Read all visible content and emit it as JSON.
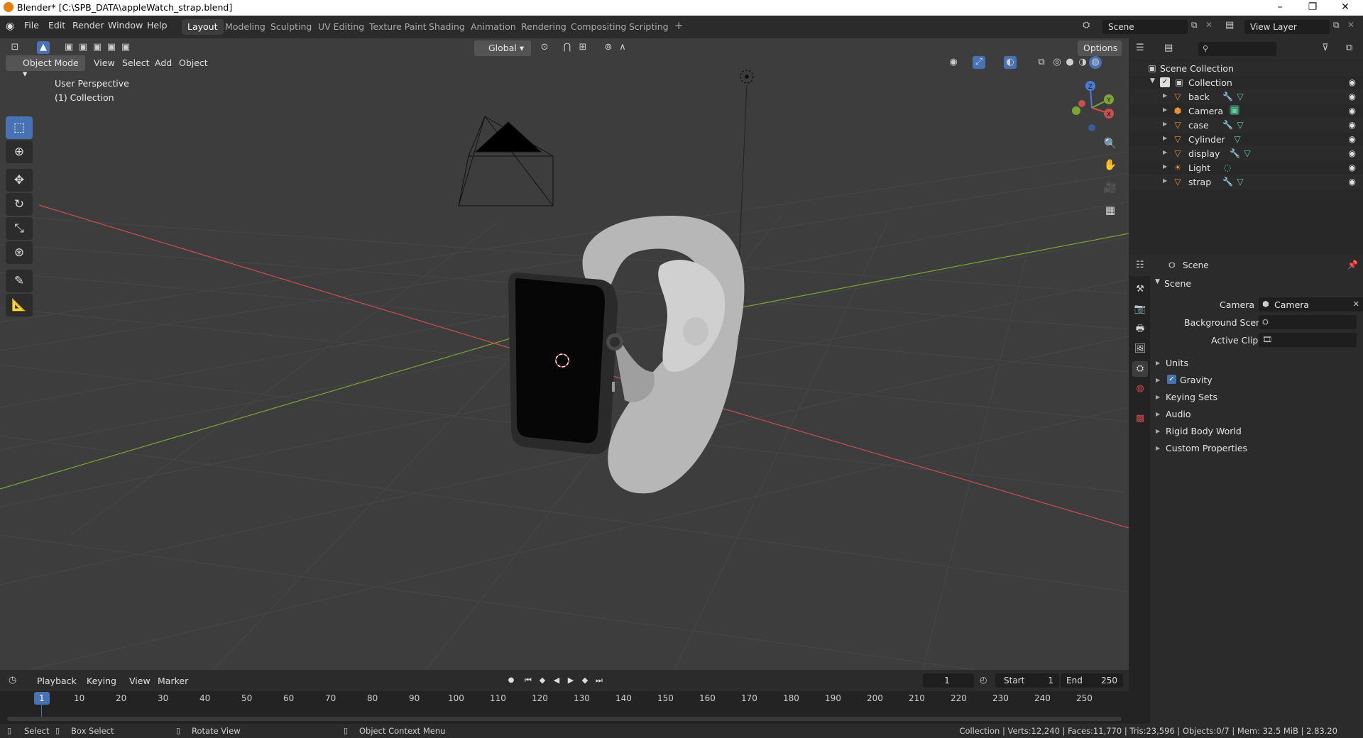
{
  "window": {
    "title": "Blender* [C:\\SPB_DATA\\appleWatch_strap.blend]",
    "minimize": "–",
    "maximize": "❐",
    "close": "✕"
  },
  "menubar": {
    "items": [
      "File",
      "Edit",
      "Render",
      "Window",
      "Help"
    ]
  },
  "workspaces": {
    "tabs": [
      "Layout",
      "Modeling",
      "Sculpting",
      "UV Editing",
      "Texture Paint",
      "Shading",
      "Animation",
      "Rendering",
      "Compositing",
      "Scripting"
    ],
    "add": "+",
    "active": "Layout"
  },
  "scene_selector": {
    "value": "Scene"
  },
  "view_layer_selector": {
    "value": "View Layer"
  },
  "viewport": {
    "orientation": "Global",
    "options": "Options",
    "mode": "Object Mode",
    "menus": [
      "View",
      "Select",
      "Add",
      "Object"
    ],
    "overlay_title": "User Perspective",
    "overlay_collection": "(1) Collection",
    "gizmo": {
      "x": "X",
      "y": "Y",
      "z": "Z"
    }
  },
  "outliner": {
    "search_placeholder": "",
    "root": "Scene Collection",
    "collection": "Collection",
    "objects": [
      {
        "name": "back",
        "icon": "mesh-icon",
        "extras": [
          "wrench-icon",
          "mesh-data-icon"
        ]
      },
      {
        "name": "Camera",
        "icon": "camera-icon",
        "extras": [
          "camera-data-icon"
        ]
      },
      {
        "name": "case",
        "icon": "mesh-icon",
        "extras": [
          "wrench-icon",
          "mesh-data-icon"
        ]
      },
      {
        "name": "Cylinder",
        "icon": "mesh-icon",
        "extras": [
          "mesh-data-icon"
        ]
      },
      {
        "name": "display",
        "icon": "mesh-icon",
        "extras": [
          "wrench-icon",
          "mesh-data-icon"
        ]
      },
      {
        "name": "Light",
        "icon": "light-icon",
        "extras": [
          "light-data-icon"
        ]
      },
      {
        "name": "strap",
        "icon": "mesh-icon",
        "extras": [
          "wrench-icon",
          "mesh-data-icon"
        ]
      }
    ]
  },
  "properties": {
    "context": "Scene",
    "panel_title": "Scene",
    "fields": [
      {
        "label": "Camera",
        "value": "Camera"
      },
      {
        "label": "Background Scene",
        "value": ""
      },
      {
        "label": "Active Clip",
        "value": ""
      }
    ],
    "sections": [
      "Units",
      "Gravity",
      "Keying Sets",
      "Audio",
      "Rigid Body World",
      "Custom Properties"
    ],
    "gravity_checked": true
  },
  "timeline": {
    "menus": [
      "Playback",
      "Keying",
      "View",
      "Marker"
    ],
    "current_frame": "1",
    "start_label": "Start",
    "start": "1",
    "end_label": "End",
    "end": "250",
    "ticks": [
      "1",
      "10",
      "20",
      "30",
      "40",
      "50",
      "60",
      "70",
      "80",
      "90",
      "100",
      "110",
      "120",
      "130",
      "140",
      "150",
      "160",
      "170",
      "180",
      "190",
      "200",
      "210",
      "220",
      "230",
      "240",
      "250"
    ]
  },
  "statusbar": {
    "select": "Select",
    "box_select": "Box Select",
    "rotate": "Rotate View",
    "context_menu": "Object Context Menu",
    "stats": "Collection | Verts:12,240 | Faces:11,770 | Tris:23,596 | Objects:0/7 | Mem: 32.5 MiB | 2.83.20"
  },
  "colors": {
    "accent": "#4772b3",
    "x_axis": "#c8504f",
    "y_axis": "#7ca534",
    "z_axis": "#4a7bd6",
    "object_orange": "#e8933a",
    "data_green": "#5fd3a0"
  }
}
